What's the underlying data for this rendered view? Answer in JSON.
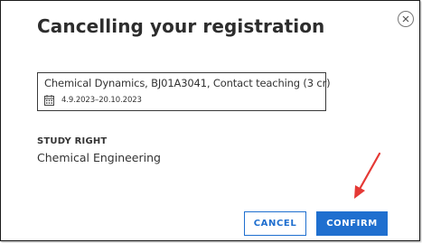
{
  "dialog": {
    "title": "Cancelling your registration",
    "close_icon": "close-icon"
  },
  "course": {
    "name": "Chemical Dynamics, BJ01A3041, Contact teaching (3 cr)",
    "dates": "4.9.2023–20.10.2023",
    "date_icon": "calendar-icon"
  },
  "study_right": {
    "label": "STUDY RIGHT",
    "value": "Chemical Engineering"
  },
  "actions": {
    "cancel_label": "CANCEL",
    "confirm_label": "CONFIRM"
  },
  "colors": {
    "accent": "#1f6fcf",
    "annotation_arrow": "#e53935"
  }
}
